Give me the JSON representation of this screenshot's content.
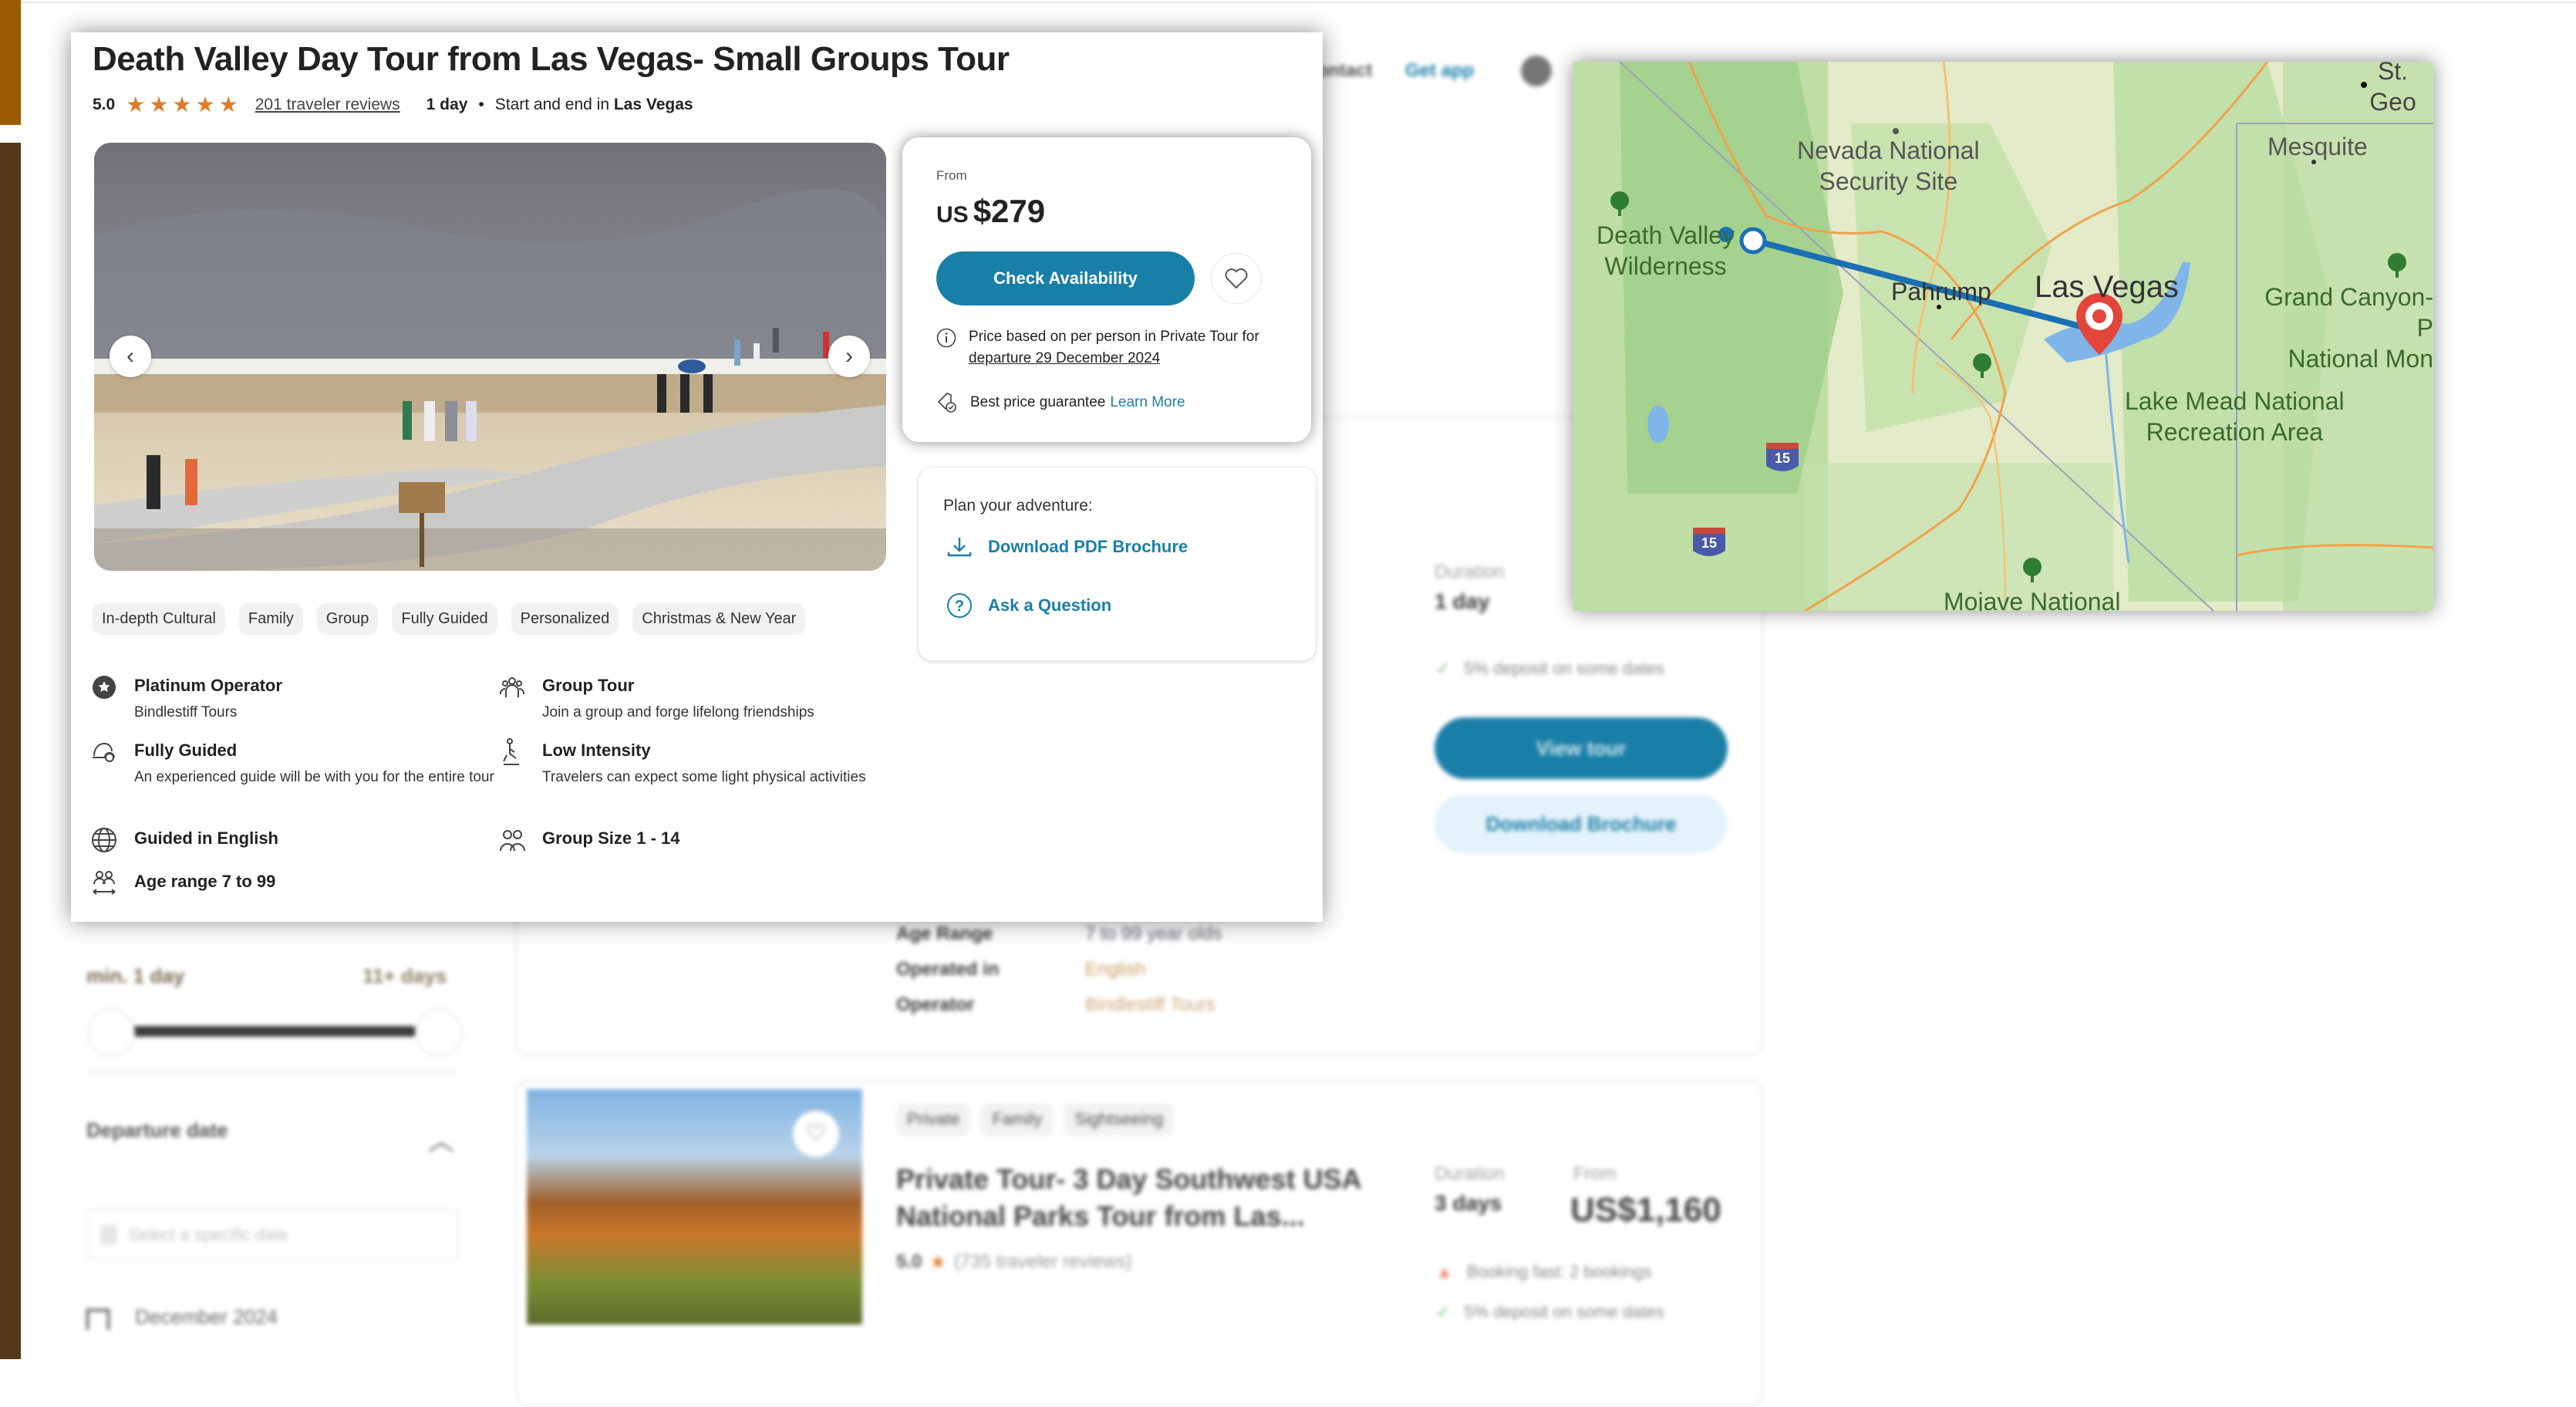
{
  "background": {
    "header": {
      "nav_partial": "Contact",
      "get_app": "Get app"
    },
    "sidebar": {
      "duration_min": "min. 1 day",
      "duration_max": "11+ days",
      "duration_range": {
        "min_days": 1,
        "max_days": 11
      },
      "departure_heading": "Departure date",
      "date_placeholder": "Select a specific date",
      "month_option": "December 2024"
    },
    "listing1": {
      "duration_label": "Duration",
      "duration_value": "1 day",
      "deposit_note": "5% deposit on some dates",
      "view_button": "View tour",
      "brochure_button": "Download Brochure",
      "details": [
        {
          "label": "Age Range",
          "value": "7 to 99 year olds"
        },
        {
          "label": "Operated in",
          "value": "English"
        },
        {
          "label": "Operator",
          "value": "Bindlestiff Tours"
        }
      ]
    },
    "listing2": {
      "tags": [
        "Private",
        "Family",
        "Sightseeing"
      ],
      "title": "Private Tour- 3 Day Southwest USA National Parks Tour from Las...",
      "rating": "5.0",
      "reviews": "(735 traveler reviews)",
      "duration_label": "Duration",
      "duration_value": "3 days",
      "from_label": "From",
      "price": "US$1,160",
      "booking_note": "Booking fast: 2 bookings",
      "deposit_note": "5% deposit on some dates"
    }
  },
  "tour": {
    "title": "Death Valley Day Tour from Las Vegas- Small Groups Tour",
    "rating": "5.0",
    "stars": 5,
    "reviews_link": "201 traveler reviews",
    "duration": "1 day",
    "separator": "•",
    "start_end_prefix": "Start and end in",
    "start_end_city": "Las Vegas",
    "gallery": {
      "prev_icon": "chevron-left-icon",
      "next_icon": "chevron-right-icon"
    },
    "tags": [
      "In-depth Cultural",
      "Family",
      "Group",
      "Fully Guided",
      "Personalized",
      "Christmas & New Year"
    ],
    "features": [
      {
        "icon": "platinum-badge-icon",
        "title": "Platinum Operator",
        "subtitle": "Bindlestiff Tours"
      },
      {
        "icon": "group-tour-icon",
        "title": "Group Tour",
        "subtitle": "Join a group and forge lifelong friendships"
      },
      {
        "icon": "guide-cap-icon",
        "title": "Fully Guided",
        "subtitle": "An experienced guide will be with you for the entire tour"
      },
      {
        "icon": "low-intensity-icon",
        "title": "Low Intensity",
        "subtitle": "Travelers can expect some light physical activities"
      },
      {
        "icon": "globe-icon",
        "title": "Guided in English",
        "subtitle": ""
      },
      {
        "icon": "group-size-icon",
        "title": "Group Size 1 - 14",
        "subtitle": ""
      },
      {
        "icon": "age-range-icon",
        "title": "Age range 7 to 99",
        "subtitle": ""
      }
    ]
  },
  "pricing": {
    "from_label": "From",
    "currency": "US",
    "amount": "$279",
    "check_button": "Check Availability",
    "price_note_line1": "Price based on per person in Private Tour for",
    "price_note_date": "departure 29 December 2024",
    "guarantee_text": "Best price guarantee",
    "learn_more": "Learn More",
    "accent_color": "#1a7fa6"
  },
  "plan": {
    "heading": "Plan your adventure:",
    "download_link": "Download PDF Brochure",
    "ask_link": "Ask a Question"
  },
  "map": {
    "labels": {
      "st_george": "St. Geo",
      "nevada": "Nevada National\nSecurity Site",
      "mesquite": "Mesquite",
      "death_valley": "Death Valley\nWilderness",
      "pahrump": "Pahrump",
      "las_vegas": "Las Vegas",
      "grand_canyon": "Grand Canyon-P\nNational Mon",
      "lake_mead": "Lake Mead National\nRecreation Area",
      "mojave": "Mojave National",
      "interstate": "15"
    },
    "route_color": "#1b6fb3",
    "marker_color": "#e2463a"
  }
}
